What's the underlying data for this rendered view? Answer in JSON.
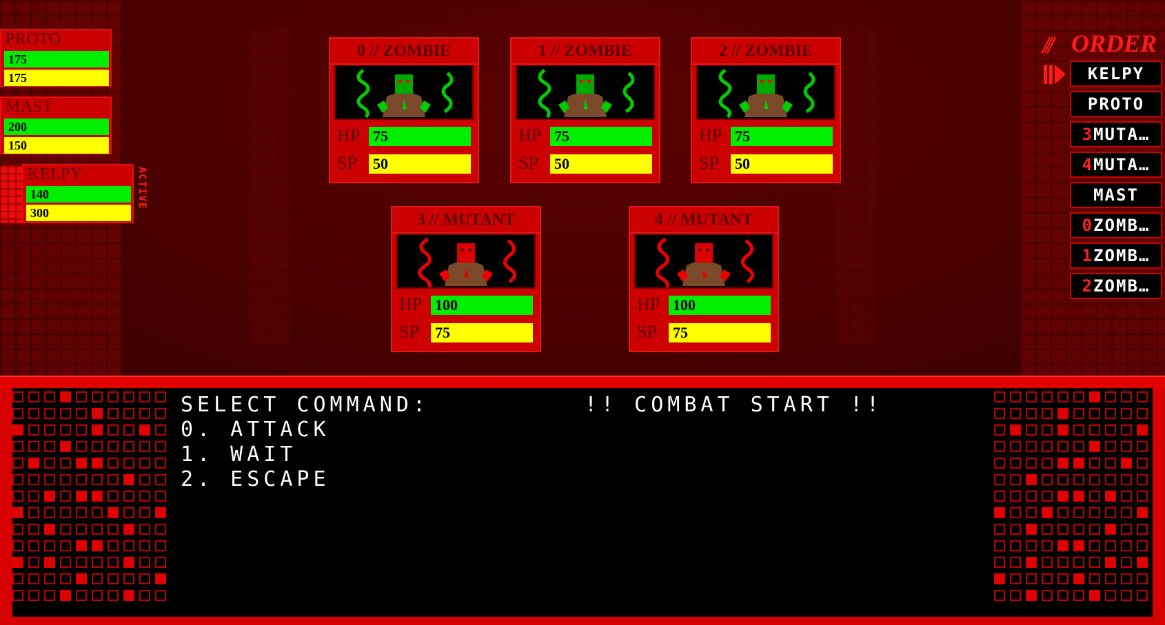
{
  "party": [
    {
      "name": "PROTO",
      "hp": "175",
      "sp": "175"
    },
    {
      "name": "MAST",
      "hp": "200",
      "sp": "150"
    },
    {
      "name": "KELPY",
      "hp": "140",
      "sp": "300",
      "status": "ACTIVE"
    }
  ],
  "enemies": [
    {
      "title": "0 // ZOMBIE",
      "hp_label": "HP",
      "hp": "75",
      "sp_label": "SP",
      "sp": "50",
      "color": "#00cc00"
    },
    {
      "title": "1 // ZOMBIE",
      "hp_label": "HP",
      "hp": "75",
      "sp_label": "SP",
      "sp": "50",
      "color": "#00cc00"
    },
    {
      "title": "2 // ZOMBIE",
      "hp_label": "HP",
      "hp": "75",
      "sp_label": "SP",
      "sp": "50",
      "color": "#00cc00"
    },
    {
      "title": "3 // MUTANT",
      "hp_label": "HP",
      "hp": "100",
      "sp_label": "SP",
      "sp": "75",
      "color": "#ee0000"
    },
    {
      "title": "4 // MUTANT",
      "hp_label": "HP",
      "hp": "100",
      "sp_label": "SP",
      "sp": "75",
      "color": "#ee0000"
    }
  ],
  "order": {
    "slashes": "///",
    "title": "ORDER",
    "items": [
      {
        "index": "",
        "label": "KELPY"
      },
      {
        "index": "",
        "label": "PROTO"
      },
      {
        "index": "3",
        "label": "MUTA…"
      },
      {
        "index": "4",
        "label": "MUTA…"
      },
      {
        "index": "",
        "label": "MAST"
      },
      {
        "index": "0",
        "label": "ZOMB…"
      },
      {
        "index": "1",
        "label": "ZOMB…"
      },
      {
        "index": "2",
        "label": "ZOMB…"
      }
    ]
  },
  "console": {
    "prompt": "SELECT COMMAND:",
    "options": [
      "0. ATTACK",
      "1. WAIT",
      "2. ESCAPE"
    ],
    "message": "!! COMBAT START !!"
  },
  "colors": {
    "hp": "#00ee00",
    "sp": "#ffff00",
    "panel": "#cc0000",
    "background": "#4a0000"
  }
}
